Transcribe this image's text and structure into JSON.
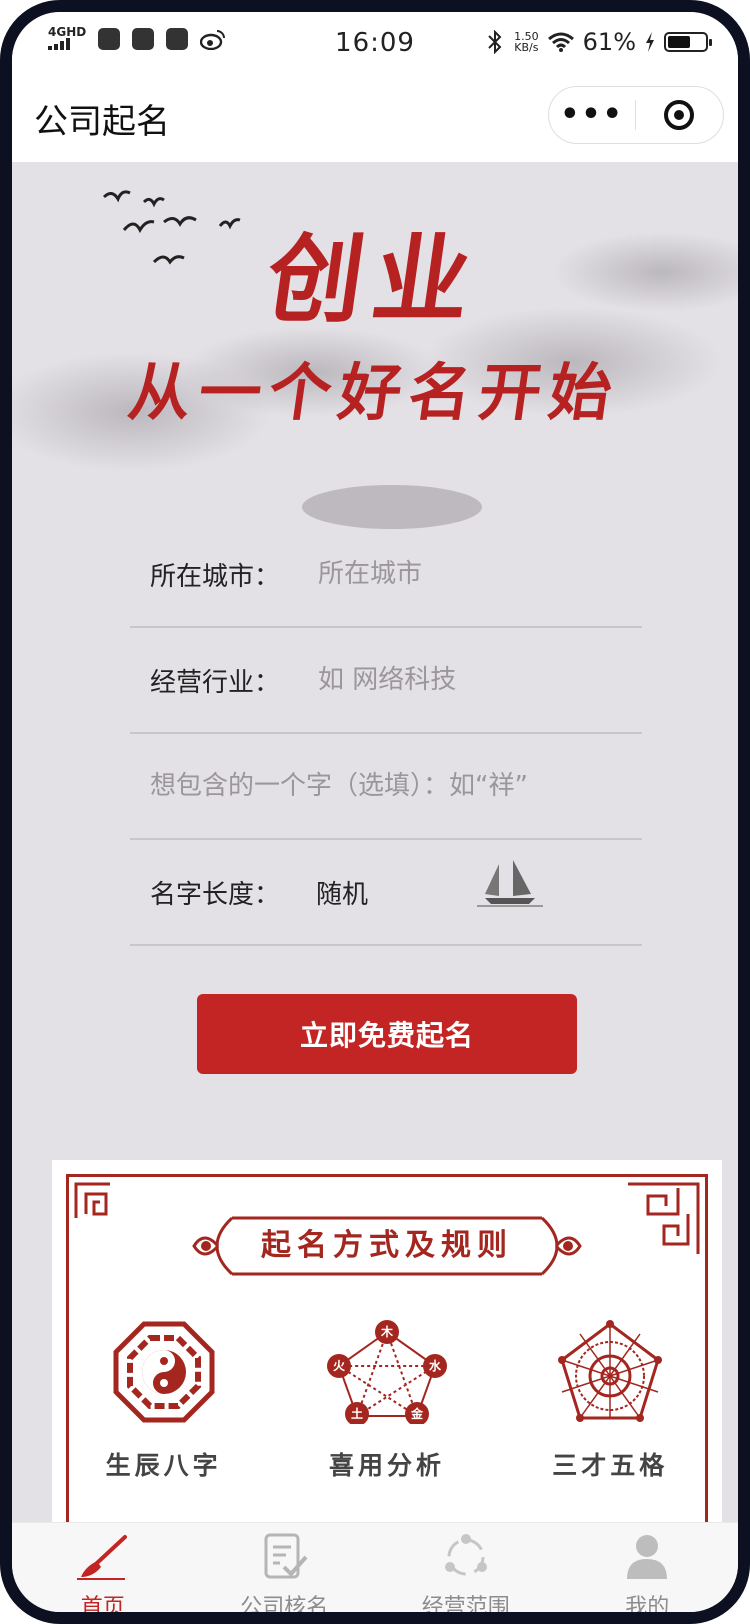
{
  "status_bar": {
    "network": "4GHD",
    "time": "16:09",
    "net_speed": "1.50",
    "net_speed_unit": "KB/s",
    "battery": "61%",
    "battery_level": 0.61
  },
  "navbar": {
    "title": "公司起名",
    "more_label": "•••"
  },
  "banner": {
    "slogan_main": "创业",
    "slogan_sub": "从一个好名开始"
  },
  "form": {
    "city": {
      "label": "所在城市：",
      "placeholder": "所在城市"
    },
    "industry": {
      "label": "经营行业：",
      "placeholder": "如 网络科技"
    },
    "keyword": {
      "placeholder": "想包含的一个字（选填）：如“祥”"
    },
    "length": {
      "label": "名字长度：",
      "value": "随机"
    }
  },
  "cta": {
    "label": "立即免费起名"
  },
  "rules_card": {
    "title": "起名方式及规则",
    "features": [
      {
        "label": "生辰八字",
        "icon": "bagua-icon"
      },
      {
        "label": "喜用分析",
        "icon": "five-elements-icon",
        "elements": [
          "木",
          "水",
          "金",
          "土",
          "火"
        ]
      },
      {
        "label": "三才五格",
        "icon": "pentagon-grid-icon"
      }
    ]
  },
  "tabbar": {
    "tabs": [
      {
        "label": "首页",
        "icon": "brush-icon",
        "active": true
      },
      {
        "label": "公司核名",
        "icon": "document-check-icon",
        "active": false
      },
      {
        "label": "经营范围",
        "icon": "cycle-icon",
        "active": false
      },
      {
        "label": "我的",
        "icon": "user-icon",
        "active": false
      }
    ]
  },
  "colors": {
    "accent": "#c32524",
    "calligraphy_red": "#b62222",
    "frame_red": "#a3261f",
    "background": "#e4e1e6",
    "tab_inactive": "#8c8c8c"
  }
}
